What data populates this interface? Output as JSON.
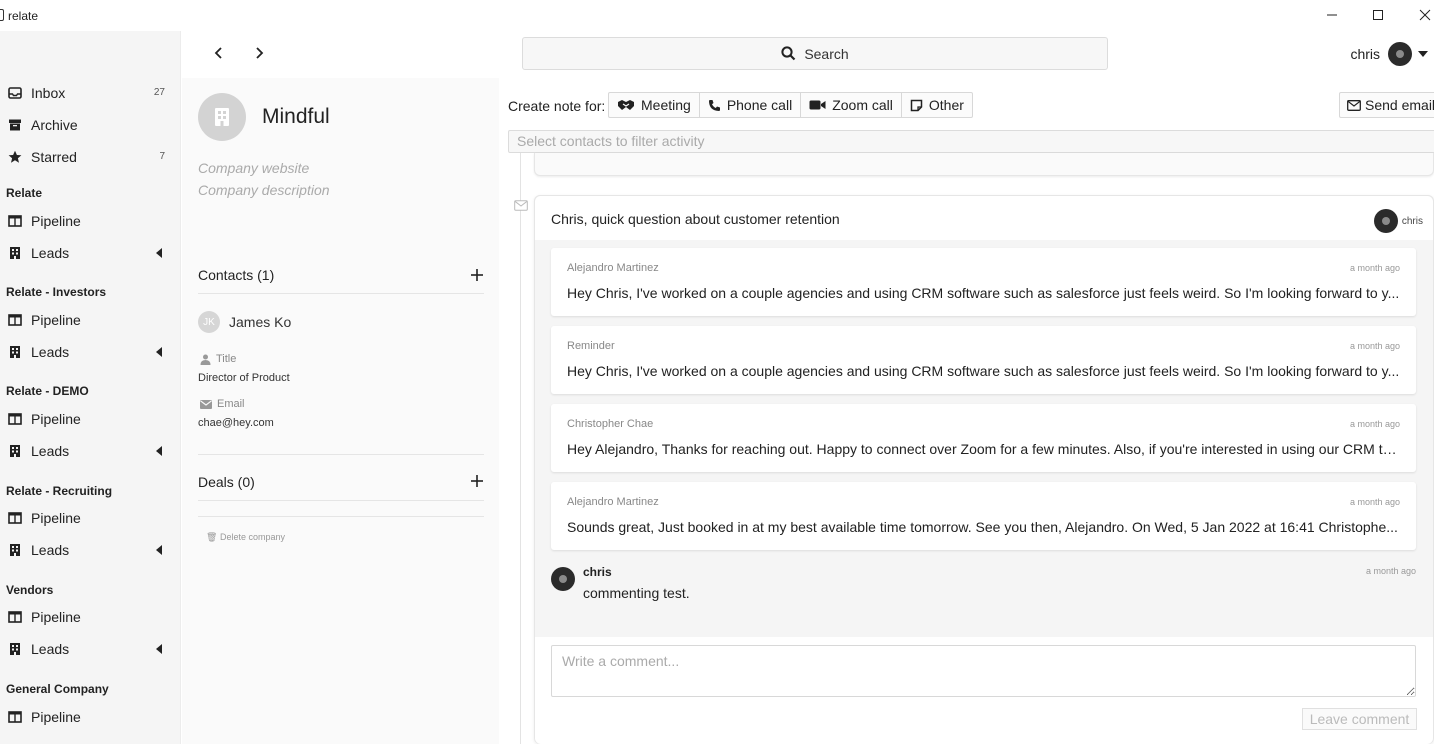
{
  "window": {
    "title": "relate"
  },
  "sidebar": {
    "top_items": [
      {
        "label": "Inbox",
        "count": "27",
        "icon": "inbox-icon"
      },
      {
        "label": "Archive",
        "count": "",
        "icon": "archive-icon"
      },
      {
        "label": "Starred",
        "count": "7",
        "icon": "star-icon"
      }
    ],
    "sections": [
      {
        "title": "Relate",
        "items": [
          "Pipeline",
          "Leads"
        ]
      },
      {
        "title": "Relate - Investors",
        "items": [
          "Pipeline",
          "Leads"
        ]
      },
      {
        "title": "Relate - DEMO",
        "items": [
          "Pipeline",
          "Leads"
        ]
      },
      {
        "title": "Relate - Recruiting",
        "items": [
          "Pipeline",
          "Leads"
        ]
      },
      {
        "title": "Vendors",
        "items": [
          "Pipeline",
          "Leads"
        ]
      },
      {
        "title": "General Company",
        "items": [
          "Pipeline"
        ]
      }
    ]
  },
  "header": {
    "search_label": "Search",
    "user_name": "chris"
  },
  "company": {
    "name": "Mindful",
    "website_placeholder": "Company website",
    "description_placeholder": "Company description",
    "contacts_heading": "Contacts (1)",
    "contact": {
      "initials": "JK",
      "name": "James Ko",
      "title_label": "Title",
      "title_value": "Director of Product",
      "email_label": "Email",
      "email_value": "chae@hey.com"
    },
    "deals_heading": "Deals (0)",
    "delete_label": "Delete company"
  },
  "activity": {
    "create_note_label": "Create note for:",
    "note_types": [
      {
        "label": "Meeting",
        "icon": "handshake-icon"
      },
      {
        "label": "Phone call",
        "icon": "phone-icon"
      },
      {
        "label": "Zoom call",
        "icon": "video-icon"
      },
      {
        "label": "Other",
        "icon": "note-icon"
      }
    ],
    "send_email_label": "Send email",
    "filter_placeholder": "Select contacts to filter activity",
    "thread": {
      "subject": "Chris, quick question about customer retention",
      "owner": "chris",
      "messages": [
        {
          "from": "Alejandro Martinez",
          "time": "a month ago",
          "body": "Hey Chris, I've worked on a couple agencies and using CRM software such as salesforce just feels weird. So I'm looking forward to y..."
        },
        {
          "from": "Reminder",
          "time": "a month ago",
          "body": "Hey Chris, I've worked on a couple agencies and using CRM software such as salesforce just feels weird. So I'm looking forward to y..."
        },
        {
          "from": "Christopher Chae",
          "time": "a month ago",
          "body": "Hey Alejandro, Thanks for reaching out. Happy to connect over Zoom for a few minutes. Also, if you're interested in using our CRM to..."
        },
        {
          "from": "Alejandro Martinez",
          "time": "a month ago",
          "body": "Sounds great, Just booked in at my best available time tomorrow. See you then, Alejandro. On Wed, 5 Jan 2022 at 16:41 Christophe..."
        }
      ],
      "comment": {
        "author": "chris",
        "time": "a month ago",
        "text": "commenting test."
      },
      "comment_placeholder": "Write a comment...",
      "leave_comment_label": "Leave comment"
    }
  }
}
